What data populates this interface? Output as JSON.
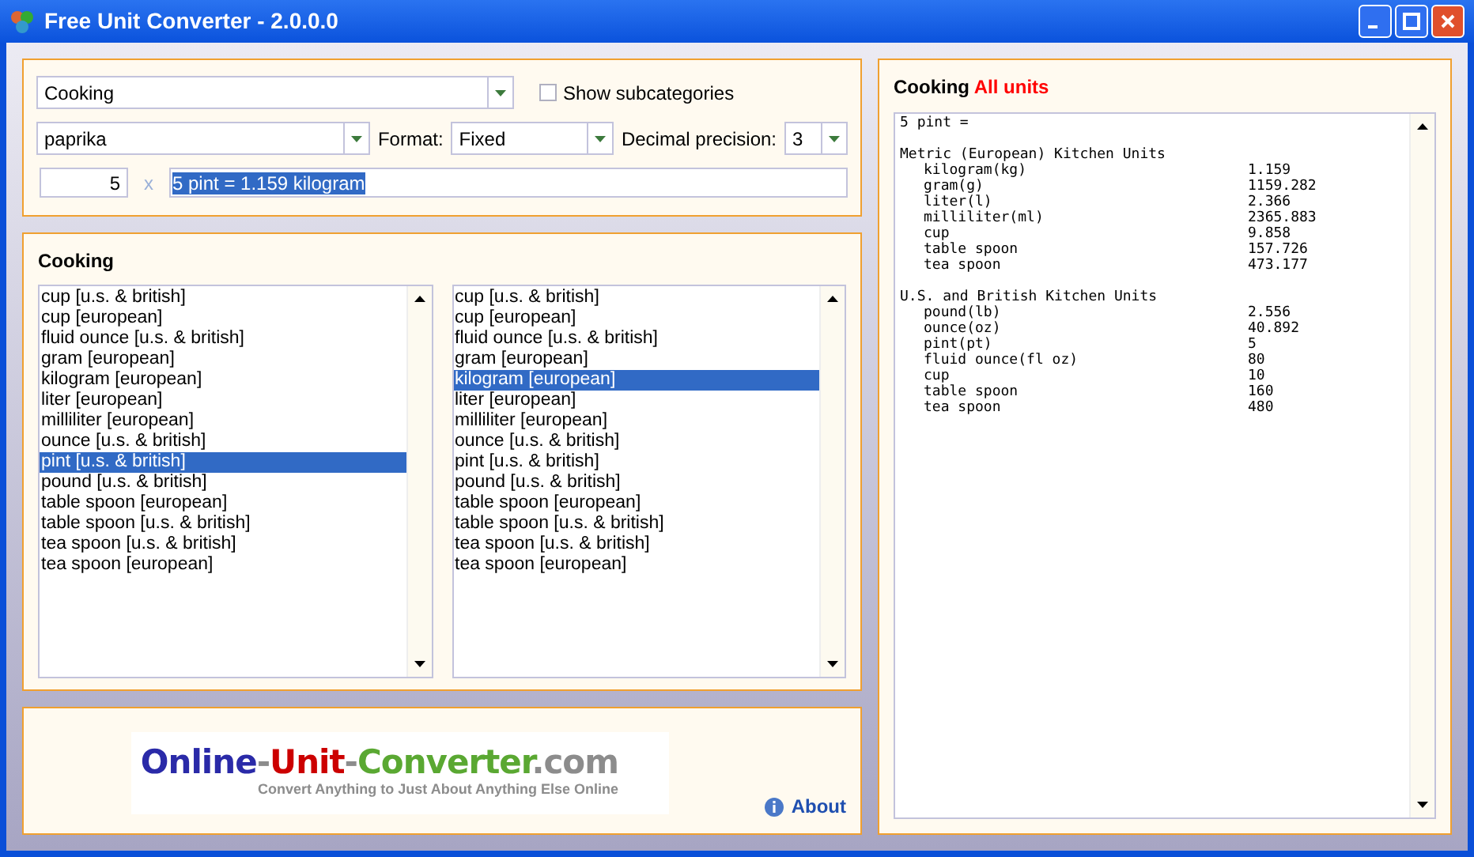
{
  "window": {
    "title": "Free Unit Converter - 2.0.0.0"
  },
  "controls": {
    "category": "Cooking",
    "show_subcategories": {
      "label": "Show subcategories",
      "checked": false
    },
    "substance": "paprika",
    "format_label": "Format:",
    "format": "Fixed",
    "precision_label": "Decimal precision:",
    "precision": "3",
    "amount": "5",
    "times": "x",
    "result": "5 pint = 1.159 kilogram"
  },
  "units_panel": {
    "title": "Cooking",
    "from_list": [
      {
        "label": "cup [u.s. & british]",
        "selected": false
      },
      {
        "label": "cup [european]",
        "selected": false
      },
      {
        "label": "fluid ounce [u.s. & british]",
        "selected": false
      },
      {
        "label": "gram [european]",
        "selected": false
      },
      {
        "label": "kilogram [european]",
        "selected": false
      },
      {
        "label": "liter [european]",
        "selected": false
      },
      {
        "label": "milliliter [european]",
        "selected": false
      },
      {
        "label": "ounce [u.s. & british]",
        "selected": false
      },
      {
        "label": "pint [u.s. & british]",
        "selected": true
      },
      {
        "label": "pound [u.s. & british]",
        "selected": false
      },
      {
        "label": "table spoon [european]",
        "selected": false
      },
      {
        "label": "table spoon [u.s. & british]",
        "selected": false
      },
      {
        "label": "tea spoon [u.s. & british]",
        "selected": false
      },
      {
        "label": "tea spoon [european]",
        "selected": false
      }
    ],
    "to_list": [
      {
        "label": "cup [u.s. & british]",
        "selected": false
      },
      {
        "label": "cup [european]",
        "selected": false
      },
      {
        "label": "fluid ounce [u.s. & british]",
        "selected": false
      },
      {
        "label": "gram [european]",
        "selected": false
      },
      {
        "label": "kilogram [european]",
        "selected": true
      },
      {
        "label": "liter [european]",
        "selected": false
      },
      {
        "label": "milliliter [european]",
        "selected": false
      },
      {
        "label": "ounce [u.s. & british]",
        "selected": false
      },
      {
        "label": "pint [u.s. & british]",
        "selected": false
      },
      {
        "label": "pound [u.s. & british]",
        "selected": false
      },
      {
        "label": "table spoon [european]",
        "selected": false
      },
      {
        "label": "table spoon [u.s. & british]",
        "selected": false
      },
      {
        "label": "tea spoon [u.s. & british]",
        "selected": false
      },
      {
        "label": "tea spoon [european]",
        "selected": false
      }
    ]
  },
  "logo": {
    "parts": [
      {
        "text": "Online",
        "color": "#2a2aa8"
      },
      {
        "text": "-",
        "color": "#8c8c8c"
      },
      {
        "text": "Unit",
        "color": "#cc0000"
      },
      {
        "text": "-",
        "color": "#8c8c8c"
      },
      {
        "text": "Converter",
        "color": "#5aa832"
      },
      {
        "text": ".com",
        "color": "#8c8c8c"
      }
    ],
    "tagline": "Convert Anything to Just About Anything Else Online"
  },
  "about": "About",
  "all_units": {
    "title": "Cooking",
    "highlight": "All units",
    "header": "5 pint =",
    "groups": [
      {
        "title": "Metric (European) Kitchen Units",
        "rows": [
          {
            "unit": "kilogram(kg)",
            "value": "1.159"
          },
          {
            "unit": "gram(g)",
            "value": "1159.282"
          },
          {
            "unit": "liter(l)",
            "value": "2.366"
          },
          {
            "unit": "milliliter(ml)",
            "value": "2365.883"
          },
          {
            "unit": "cup",
            "value": "9.858"
          },
          {
            "unit": "table spoon",
            "value": "157.726"
          },
          {
            "unit": "tea spoon",
            "value": "473.177"
          }
        ]
      },
      {
        "title": "U.S. and British Kitchen Units",
        "rows": [
          {
            "unit": "pound(lb)",
            "value": "2.556"
          },
          {
            "unit": "ounce(oz)",
            "value": "40.892"
          },
          {
            "unit": "pint(pt)",
            "value": "5"
          },
          {
            "unit": "fluid ounce(fl oz)",
            "value": "80"
          },
          {
            "unit": "cup",
            "value": "10"
          },
          {
            "unit": "table spoon",
            "value": "160"
          },
          {
            "unit": "tea spoon",
            "value": "480"
          }
        ]
      }
    ]
  }
}
